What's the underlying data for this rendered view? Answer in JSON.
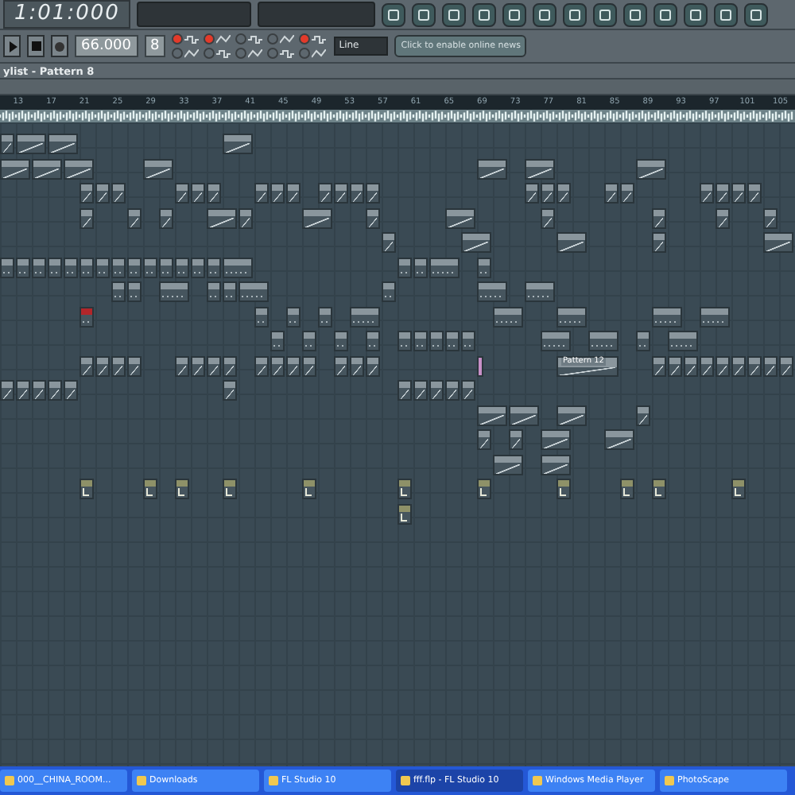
{
  "toolbar": {
    "time": "1:01:000",
    "tempo": "66.000",
    "pattern": "8",
    "snap": "Line",
    "news": "Click to enable online news",
    "modes": [
      {
        "on": true
      },
      {
        "on": true
      },
      {
        "on": false
      },
      {
        "on": false
      },
      {
        "on": true
      },
      {
        "on": false
      },
      {
        "on": false
      },
      {
        "on": false
      },
      {
        "on": false
      },
      {
        "on": false
      }
    ]
  },
  "playlist": {
    "title": "ylist - Pattern 8",
    "ruler": [
      "13",
      "17",
      "21",
      "25",
      "29",
      "33",
      "37",
      "41",
      "45",
      "49",
      "53",
      "57",
      "61",
      "65",
      "69",
      "73",
      "77",
      "81",
      "85",
      "89",
      "93",
      "97",
      "101",
      "105"
    ],
    "clip_labels": [
      "Pattern 12"
    ]
  },
  "taskbar": {
    "items": [
      {
        "label": "000__CHINA_ROOM...",
        "selected": false
      },
      {
        "label": "Downloads",
        "selected": false
      },
      {
        "label": "FL Studio 10",
        "selected": false
      },
      {
        "label": "fff.flp - FL Studio 10",
        "selected": true
      },
      {
        "label": "Windows Media Player",
        "selected": false
      },
      {
        "label": "PhotoScape",
        "selected": false
      }
    ]
  }
}
